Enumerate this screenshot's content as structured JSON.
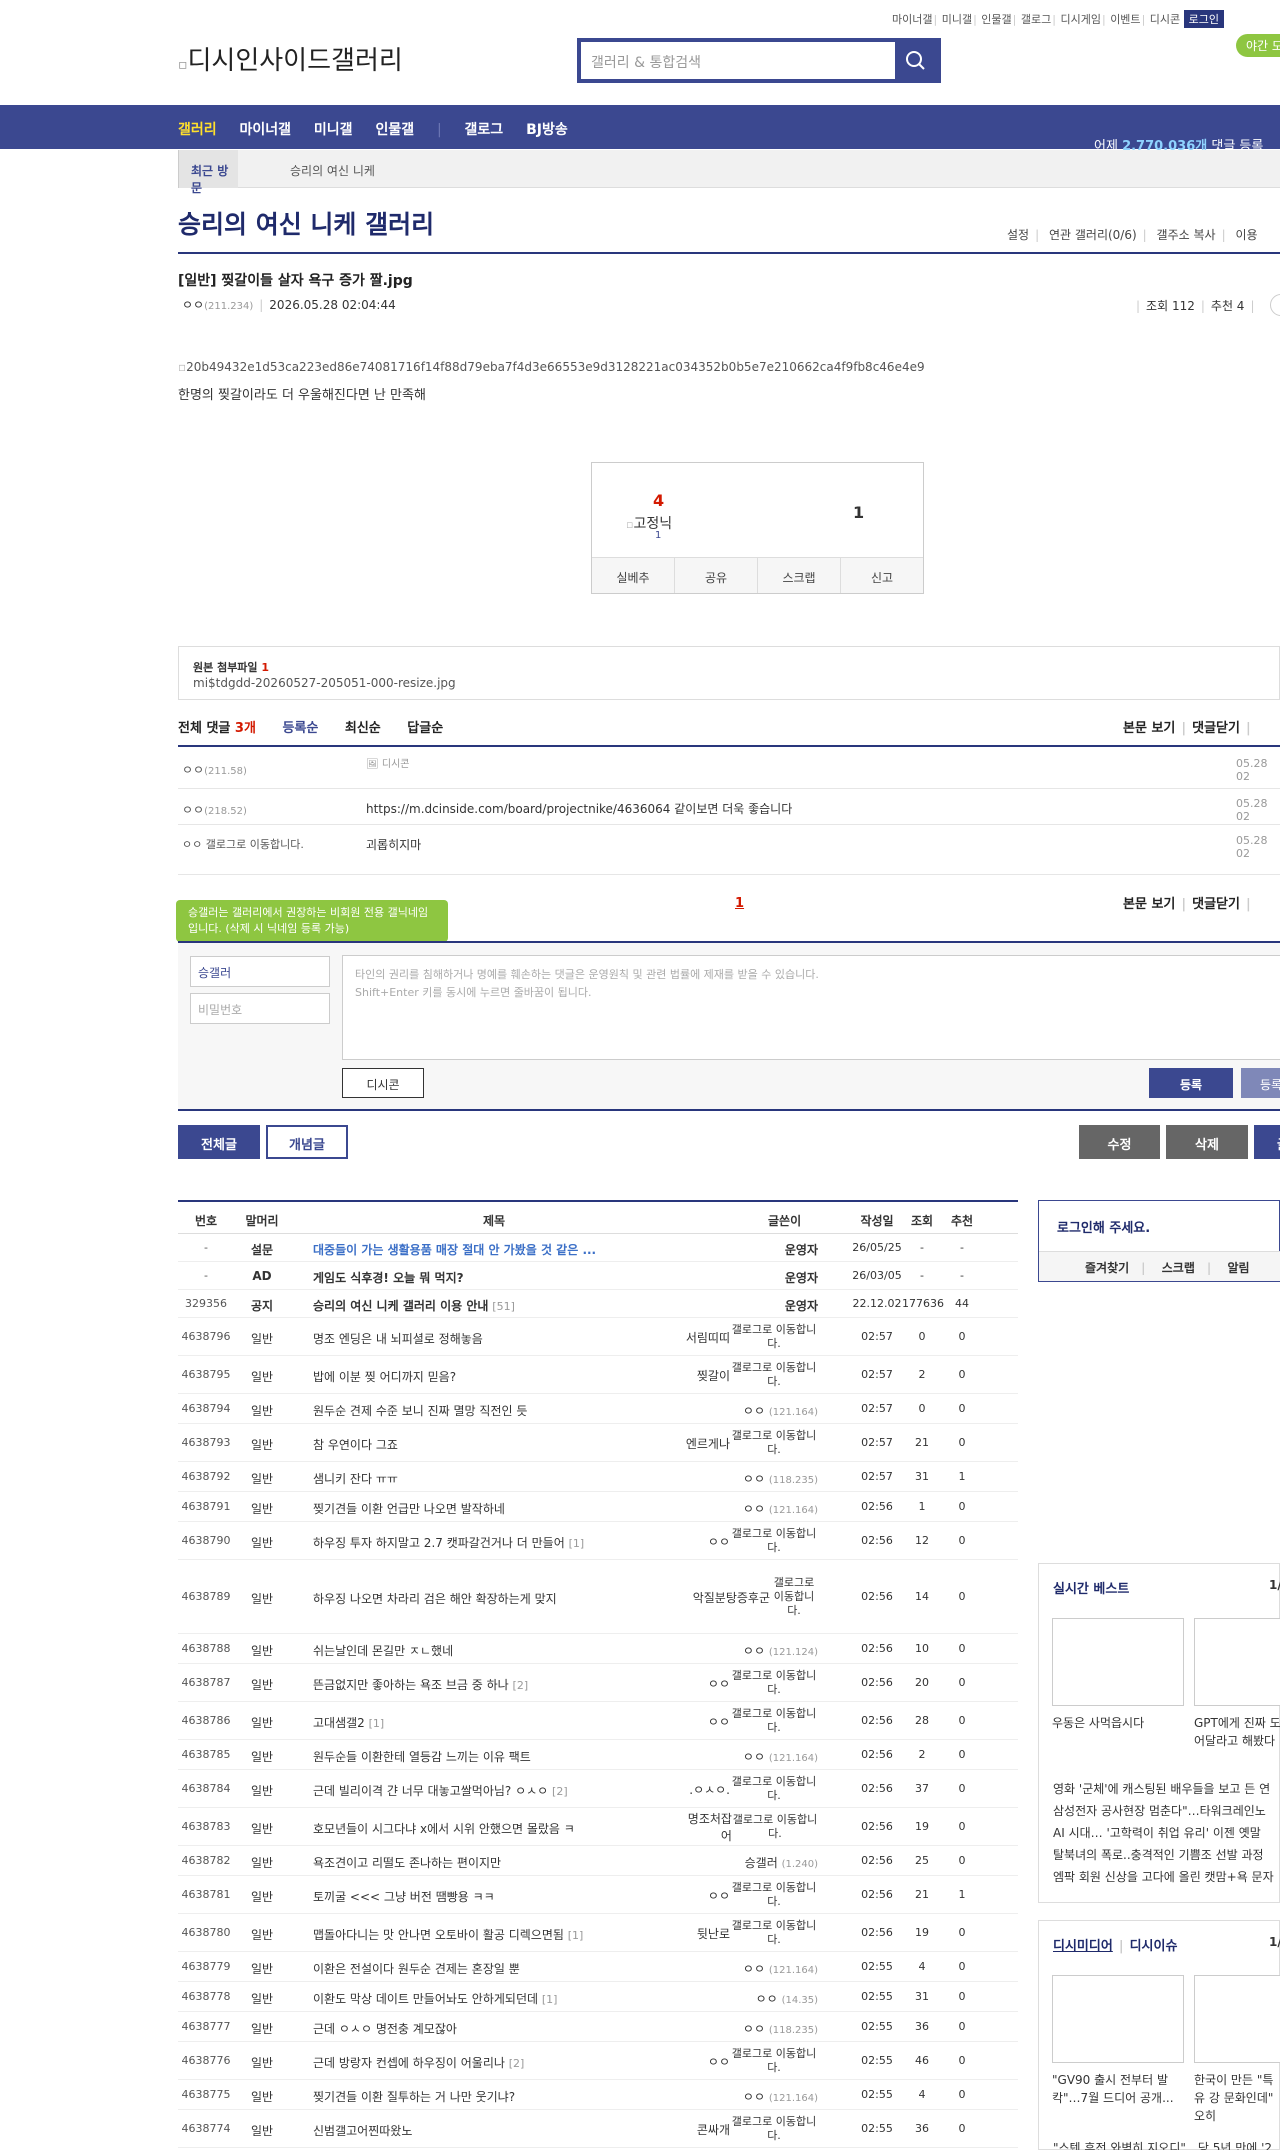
{
  "top_links": [
    "마이너갤",
    "미니갤",
    "인물갤",
    "갤로그",
    "디시게임",
    "이벤트",
    "디시콘"
  ],
  "login_label": "로그인",
  "night_mode": "야간 모드",
  "logo_alt": "디시인사이드갤러리",
  "search_placeholder": "갤러리 & 통합검색",
  "nav": {
    "items": [
      "갤러리",
      "마이너갤",
      "미니갤",
      "인물갤",
      "갤로그",
      "BJ방송"
    ],
    "stat_prefix": "어제",
    "stat_count": "2,770,036개",
    "stat_suffix": "댓글 등록"
  },
  "recent": {
    "label": "최근 방문",
    "item": "승리의 여신 니케"
  },
  "gallery_title": "승리의 여신 니케 갤러리",
  "gallery_menu": [
    "설정",
    "연관 갤러리(0/6)",
    "갤주소 복사",
    "이용"
  ],
  "post": {
    "title": "[일반] 찢갈이들 살자 욕구 증가 짤.jpg",
    "writer": "ㅇㅇ",
    "writer_ip": "(211.234)",
    "date": "2026.05.28 02:04:44",
    "views": "조회 112",
    "recommend": "추천 4",
    "image_alt": "20b49432e1d53ca223ed86e74081716f14f88d79eba7f4d3e66553e9d3128221ac034352b0b5e7e210662ca4f9fb8c46e4e9",
    "body": "한명의 찢갈이라도 더 우울해진다면 난 만족해"
  },
  "recommend_box": {
    "up": "4",
    "fixed_label": "고정닉",
    "fixed_count": "1",
    "down": "1",
    "buttons": [
      "실베추",
      "공유",
      "스크랩",
      "신고"
    ]
  },
  "attachment": {
    "label": "원본 첨부파일",
    "count": "1",
    "file": "mi$tdgdd-20260527-205051-000-resize.jpg"
  },
  "comments_bar": {
    "total_label": "전체 댓글",
    "total_count": "3개",
    "sorts": [
      "등록순",
      "최신순",
      "답글순"
    ],
    "right": [
      "본문 보기",
      "댓글닫기"
    ]
  },
  "comments": [
    {
      "nick": "ㅇㅇ",
      "ip": "(211.58)",
      "content": "🖼 디시콘",
      "date": "05.28 02"
    },
    {
      "nick": "ㅇㅇ",
      "ip": "(218.52)",
      "content": "https://m.dcinside.com/board/projectnike/4636064 같이보면 더욱 좋습니다",
      "date": "05.28 02"
    },
    {
      "nick": "ㅇㅇ",
      "ip": "갤로그로 이동합니다.",
      "content": "괴롭히지마",
      "date": "05.28 02"
    }
  ],
  "comment_page": "1",
  "tip": "승갤러는 갤러리에서 권장하는 비회원 전용 갤닉네임입니다. (삭제 시 닉네임 등록 가능)",
  "write": {
    "nick": "승갤러",
    "password_placeholder": "비밀번호",
    "textarea": "타인의 권리를 침해하거나 명예를 훼손하는 댓글은 운영원칙 및 관련 법률에 제재를 받을 수 있습니다.\nShift+Enter 키를 동시에 누르면 줄바꿈이 됩니다.",
    "dccon": "디시콘",
    "submit": "등록",
    "submit2": "등록"
  },
  "list_buttons": {
    "all": "전체글",
    "concept": "개념글",
    "edit": "수정",
    "delete": "삭제",
    "write": "글쓰기"
  },
  "list_header": [
    "번호",
    "말머리",
    "제목",
    "글쓴이",
    "작성일",
    "조회",
    "추천"
  ],
  "posts": [
    {
      "no": "-",
      "head": "설문",
      "title": "대중들이 가는 생활용품 매장 절대 안 가봤을 것 같은 ...",
      "cnt": "",
      "writer": "운영자",
      "ip": "",
      "date": "26/05/25",
      "views": "-",
      "rec": "-",
      "type": "survey"
    },
    {
      "no": "-",
      "head": "AD",
      "title": "게임도 식후경! 오늘 뭐 먹지?",
      "cnt": "",
      "writer": "운영자",
      "ip": "",
      "date": "26/03/05",
      "views": "-",
      "rec": "-",
      "type": "ad"
    },
    {
      "no": "329356",
      "head": "공지",
      "title": "승리의 여신 니케 갤러리 이용 안내",
      "cnt": "[51]",
      "writer": "운영자",
      "ip": "",
      "date": "22.12.02",
      "views": "177636",
      "rec": "44",
      "type": "notice"
    },
    {
      "no": "4638796",
      "head": "일반",
      "title": "명조 엔딩은 내 뇌피셜로 정해놓음",
      "cnt": "",
      "writer": "서림띠띠",
      "ip": "갤로그로 이동합니다.",
      "date": "02:57",
      "views": "0",
      "rec": "0",
      "type": "gallog"
    },
    {
      "no": "4638795",
      "head": "일반",
      "title": "밥에 이분 찢 어디까지 믿음?",
      "cnt": "",
      "writer": "찢갈이",
      "ip": "갤로그로 이동합니다.",
      "date": "02:57",
      "views": "2",
      "rec": "0",
      "type": "gallog"
    },
    {
      "no": "4638794",
      "head": "일반",
      "title": "원두순 견제 수준 보니 진짜 멸망 직전인 듯",
      "cnt": "",
      "writer": "ㅇㅇ",
      "ip": "(121.164)",
      "date": "02:57",
      "views": "0",
      "rec": "0",
      "type": "ip"
    },
    {
      "no": "4638793",
      "head": "일반",
      "title": "참 우연이다 그죠",
      "cnt": "",
      "writer": "엔르게나",
      "ip": "갤로그로 이동합니다.",
      "date": "02:57",
      "views": "21",
      "rec": "0",
      "type": "gallog"
    },
    {
      "no": "4638792",
      "head": "일반",
      "title": "샘니키 잔다 ㅠㅠ",
      "cnt": "",
      "writer": "ㅇㅇ",
      "ip": "(118.235)",
      "date": "02:57",
      "views": "31",
      "rec": "1",
      "type": "ip"
    },
    {
      "no": "4638791",
      "head": "일반",
      "title": "찢기견들 이환 언급만 나오면 발작하네",
      "cnt": "",
      "writer": "ㅇㅇ",
      "ip": "(121.164)",
      "date": "02:56",
      "views": "1",
      "rec": "0",
      "type": "ip"
    },
    {
      "no": "4638790",
      "head": "일반",
      "title": "하우징 투자 하지말고 2.7 캣파갈건거나 더 만들어",
      "cnt": "[1]",
      "writer": "ㅇㅇ",
      "ip": "갤로그로 이동합니다.",
      "date": "02:56",
      "views": "12",
      "rec": "0",
      "type": "gallog"
    },
    {
      "no": "4638789",
      "head": "일반",
      "title": "하우징 나오면 차라리 검은 해안 확장하는게 맞지",
      "cnt": "",
      "writer": "악질분탕증후군",
      "ip": "갤로그로 이동합니다.",
      "date": "02:56",
      "views": "14",
      "rec": "0",
      "type": "gallog"
    },
    {
      "no": "4638788",
      "head": "일반",
      "title": "쉬는날인데 몬길만 ㅈㄴ했네",
      "cnt": "",
      "writer": "ㅇㅇ",
      "ip": "(121.124)",
      "date": "02:56",
      "views": "10",
      "rec": "0",
      "type": "ip"
    },
    {
      "no": "4638787",
      "head": "일반",
      "title": "뜬금없지만 좋아하는 욕조 브금 중 하나",
      "cnt": "[2]",
      "writer": "ㅇㅇ",
      "ip": "갤로그로 이동합니다.",
      "date": "02:56",
      "views": "20",
      "rec": "0",
      "type": "gallog"
    },
    {
      "no": "4638786",
      "head": "일반",
      "title": "고대샘갤2",
      "cnt": "[1]",
      "writer": "ㅇㅇ",
      "ip": "갤로그로 이동합니다.",
      "date": "02:56",
      "views": "28",
      "rec": "0",
      "type": "gallog"
    },
    {
      "no": "4638785",
      "head": "일반",
      "title": "원두순들 이환한테 열등감 느끼는 이유 팩트",
      "cnt": "",
      "writer": "ㅇㅇ",
      "ip": "(121.164)",
      "date": "02:56",
      "views": "2",
      "rec": "0",
      "type": "ip"
    },
    {
      "no": "4638784",
      "head": "일반",
      "title": "근데 빌리이격 갼 너무 대놓고쌀먹아님? ㅇㅅㅇ",
      "cnt": "[2]",
      "writer": ".ㅇㅅㅇ.",
      "ip": "갤로그로 이동합니다.",
      "date": "02:56",
      "views": "37",
      "rec": "0",
      "type": "gallog"
    },
    {
      "no": "4638783",
      "head": "일반",
      "title": "호모년들이 시그다냐 x에서 시위 안했으면 몰랐음 ㅋ",
      "cnt": "",
      "writer": "명조처잡어",
      "ip": "갤로그로 이동합니다.",
      "date": "02:56",
      "views": "19",
      "rec": "0",
      "type": "gallog"
    },
    {
      "no": "4638782",
      "head": "일반",
      "title": "욕조견이고 리떨도 존나하는 편이지만",
      "cnt": "",
      "writer": "승갤러",
      "ip": "(1.240)",
      "date": "02:56",
      "views": "25",
      "rec": "0",
      "type": "ip"
    },
    {
      "no": "4638781",
      "head": "일반",
      "title": "토끼굴 <<< 그냥 버전 땜빵용 ㅋㅋ",
      "cnt": "",
      "writer": "ㅇㅇ",
      "ip": "갤로그로 이동합니다.",
      "date": "02:56",
      "views": "21",
      "rec": "1",
      "type": "gallog"
    },
    {
      "no": "4638780",
      "head": "일반",
      "title": "맵돌아다니는 맛 안나면 오토바이 활공 디렉으면됨",
      "cnt": "[1]",
      "writer": "뒷난로",
      "ip": "갤로그로 이동합니다.",
      "date": "02:56",
      "views": "19",
      "rec": "0",
      "type": "gallog"
    },
    {
      "no": "4638779",
      "head": "일반",
      "title": "이환은 전설이다 원두순 견제는 혼장일 뿐",
      "cnt": "",
      "writer": "ㅇㅇ",
      "ip": "(121.164)",
      "date": "02:55",
      "views": "4",
      "rec": "0",
      "type": "ip"
    },
    {
      "no": "4638778",
      "head": "일반",
      "title": "이환도 막상 데이트 만들어놔도 안하게되던데",
      "cnt": "[1]",
      "writer": "ㅇㅇ",
      "ip": "(14.35)",
      "date": "02:55",
      "views": "31",
      "rec": "0",
      "type": "ip"
    },
    {
      "no": "4638777",
      "head": "일반",
      "title": "근데 ㅇㅅㅇ 명전충 계모잖아",
      "cnt": "",
      "writer": "ㅇㅇ",
      "ip": "(118.235)",
      "date": "02:55",
      "views": "36",
      "rec": "0",
      "type": "ip"
    },
    {
      "no": "4638776",
      "head": "일반",
      "title": "근데 방랑자 컨셉에 하우징이 어울리나",
      "cnt": "[2]",
      "writer": "ㅇㅇ",
      "ip": "갤로그로 이동합니다.",
      "date": "02:55",
      "views": "46",
      "rec": "0",
      "type": "gallog"
    },
    {
      "no": "4638775",
      "head": "일반",
      "title": "찢기견들 이환 질투하는 거 나만 웃기냐?",
      "cnt": "",
      "writer": "ㅇㅇ",
      "ip": "(121.164)",
      "date": "02:55",
      "views": "4",
      "rec": "0",
      "type": "ip"
    },
    {
      "no": "4638774",
      "head": "일반",
      "title": "신범갤고어찐따왔노",
      "cnt": "",
      "writer": "콘싸개",
      "ip": "갤로그로 이동합니다.",
      "date": "02:55",
      "views": "36",
      "rec": "0",
      "type": "gallog"
    }
  ],
  "right": {
    "login_text": "로그인해 주세요.",
    "login_menu": [
      "즐겨찾기",
      "스크랩",
      "알림"
    ],
    "best_title": "실시간 베스트",
    "best_page": "1/",
    "best_caps": [
      "우동은 사먹읍시다",
      "GPT에게 진짜 도 어달라고 해봤다"
    ],
    "best_list": [
      "영화 '군체'에 캐스팅된 배우들을 보고 든 연",
      "삼성전자 공사현장 멈춘다\"…타워크레인노",
      "AI 시대… '고학력이 취업 유리' 이젠 옛말",
      "탈북녀의 폭로..충격적인 기쁨조 선발 과정",
      "엠팍 회원 신상을 고다에 올린 캣맘+욕 문자"
    ],
    "media_title1": "디시미디어",
    "media_title2": "디시이슈",
    "media_page": "1/",
    "media_caps": [
      "\"GV90 출시 전부터 발 칵\"…7월 드디어 공개...",
      "한국이 만든 \"특유 강 문화인데\" 오히"
    ],
    "media_list": "\"스텐 휴전 와벽히 지오디\"…당 5년 만에 '2"
  }
}
